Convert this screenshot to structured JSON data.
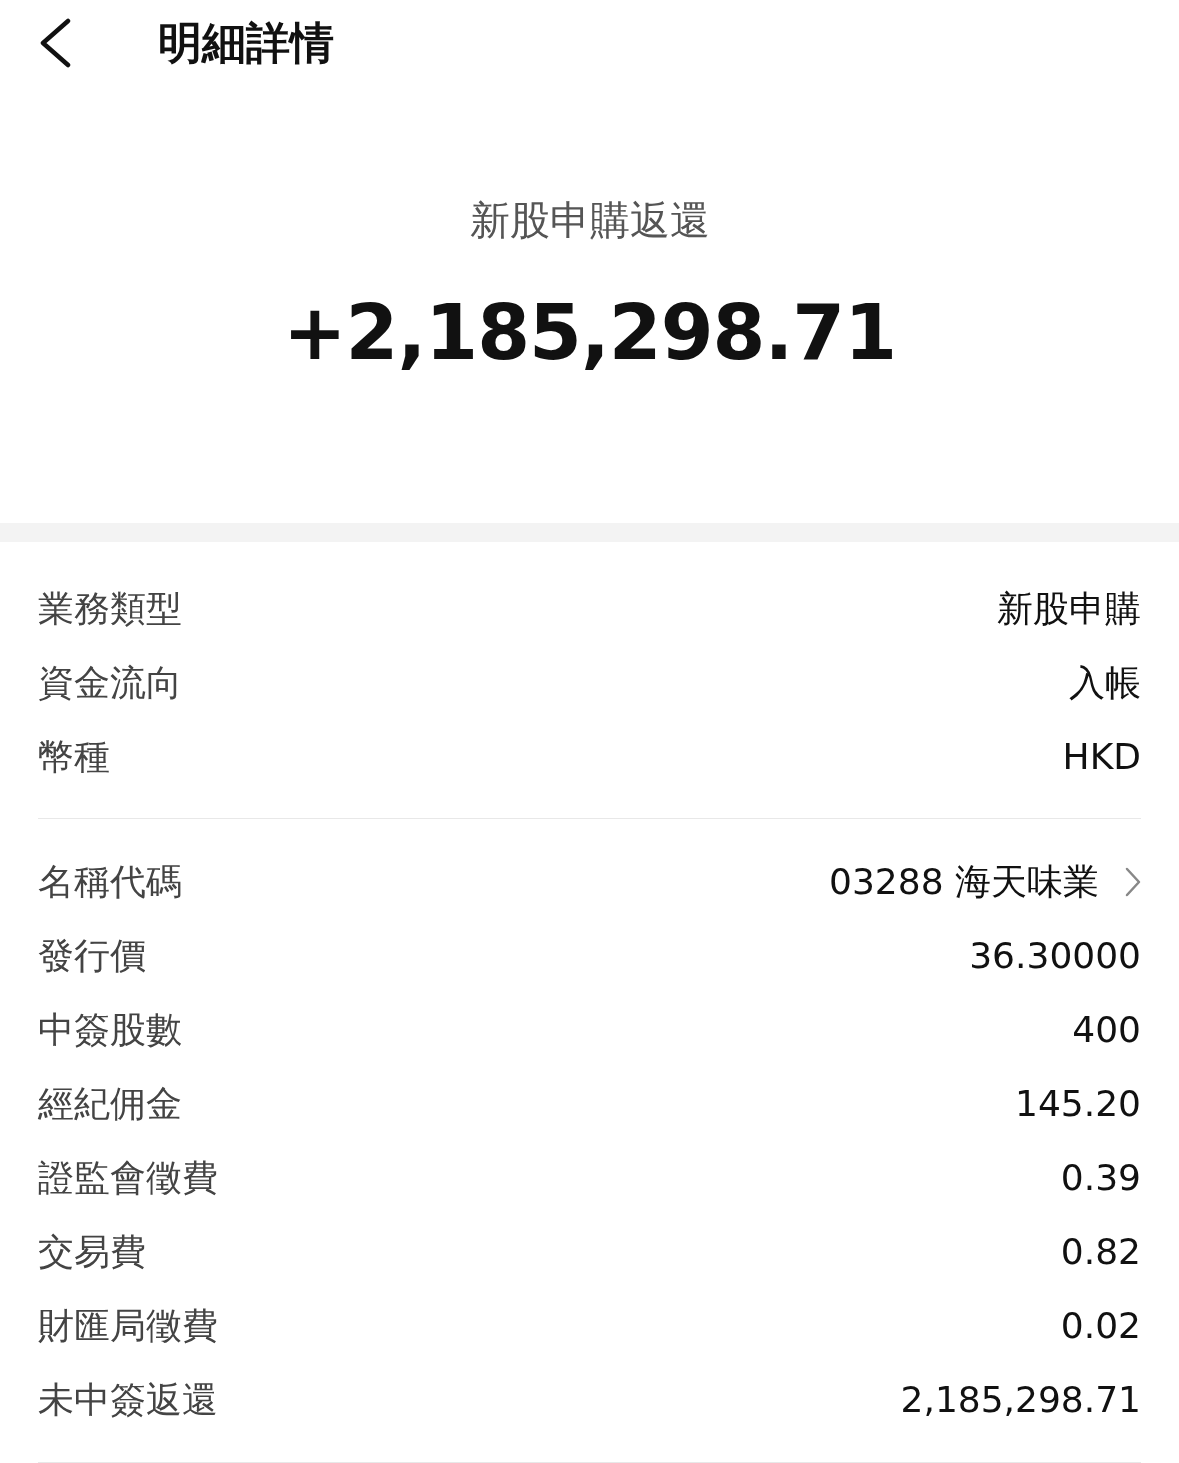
{
  "header": {
    "title": "明細詳情"
  },
  "summary": {
    "label": "新股申購返還",
    "amount": "+2,185,298.71"
  },
  "groups": [
    {
      "rows": [
        {
          "kind": "plain",
          "label": "業務類型",
          "value": "新股申購"
        },
        {
          "kind": "plain",
          "label": "資金流向",
          "value": "入帳"
        },
        {
          "kind": "plain",
          "label": "幣種",
          "value": "HKD"
        }
      ]
    },
    {
      "rows": [
        {
          "kind": "link",
          "label": "名稱代碼",
          "value": "03288 海天味業"
        },
        {
          "kind": "plain",
          "label": "發行價",
          "value": "36.30000"
        },
        {
          "kind": "plain",
          "label": "中簽股數",
          "value": "400"
        },
        {
          "kind": "plain",
          "label": "經紀佣金",
          "value": "145.20"
        },
        {
          "kind": "plain",
          "label": "證監會徵費",
          "value": "0.39"
        },
        {
          "kind": "plain",
          "label": "交易費",
          "value": "0.82"
        },
        {
          "kind": "plain",
          "label": "財匯局徵費",
          "value": "0.02"
        },
        {
          "kind": "plain",
          "label": "未中簽返還",
          "value": "2,185,298.71"
        }
      ]
    }
  ]
}
